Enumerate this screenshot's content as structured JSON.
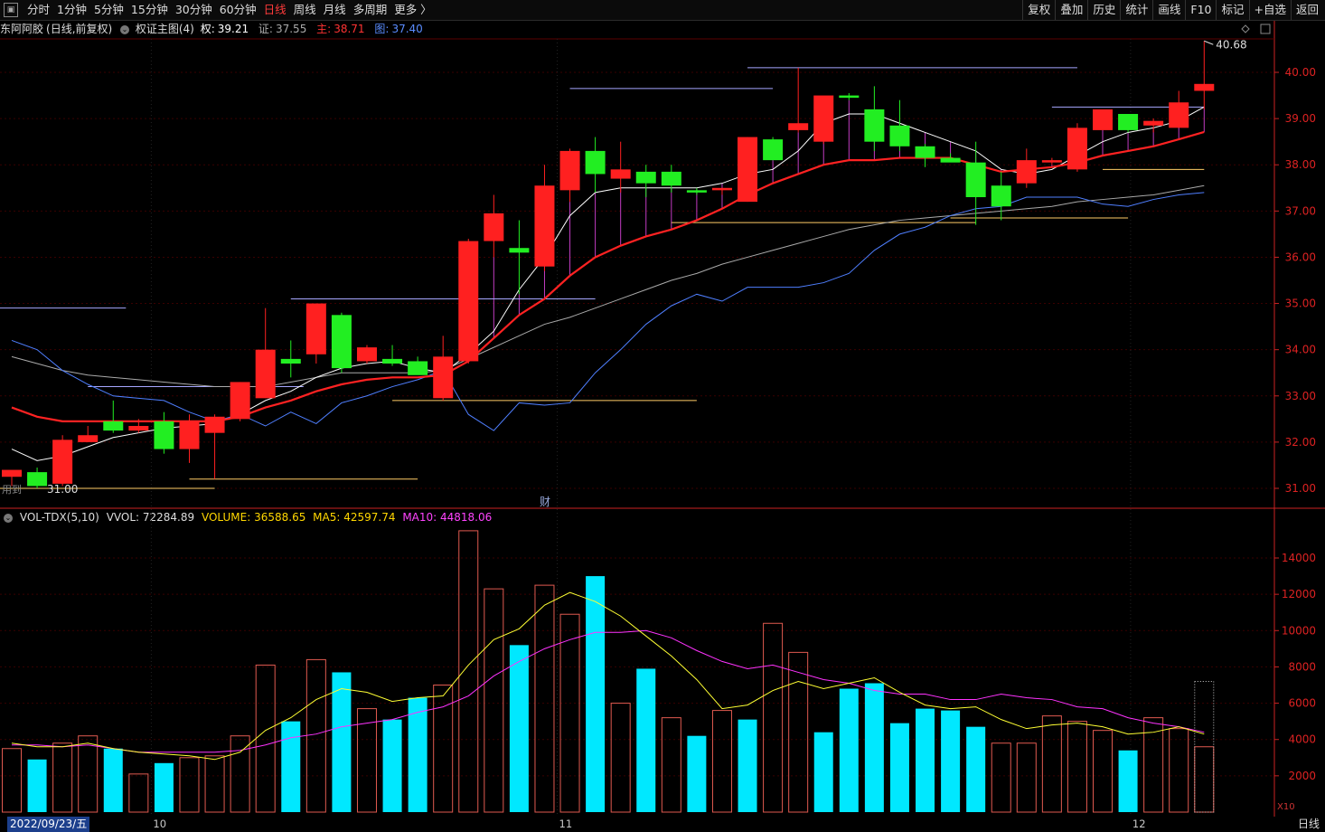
{
  "toolbar": {
    "tabs": [
      {
        "label": "分时",
        "active": false
      },
      {
        "label": "1分钟",
        "active": false
      },
      {
        "label": "5分钟",
        "active": false
      },
      {
        "label": "15分钟",
        "active": false
      },
      {
        "label": "30分钟",
        "active": false
      },
      {
        "label": "60分钟",
        "active": false
      },
      {
        "label": "日线",
        "active": true
      },
      {
        "label": "周线",
        "active": false
      },
      {
        "label": "月线",
        "active": false
      },
      {
        "label": "多周期",
        "active": false
      },
      {
        "label": "更多 〉",
        "active": false
      }
    ],
    "right_buttons": [
      "复权",
      "叠加",
      "历史",
      "统计",
      "画线",
      "F10",
      "标记",
      "+自选",
      "返回"
    ]
  },
  "info": {
    "name": "东阿阿胶",
    "mode": "(日线,前复权)",
    "indicator": "权证主图(4)",
    "quan_label": "权:",
    "quan_value": "39.21",
    "zheng_label": "证:",
    "zheng_value": "37.55",
    "zhu_label": "主:",
    "zhu_value": "38.71",
    "tu_label": "图:",
    "tu_value": "37.40"
  },
  "vol_info": {
    "name": "VOL-TDX(5,10)",
    "vvol": "VVOL: 72284.89",
    "volume": "VOLUME: 36588.65",
    "ma5": "MA5: 42597.74",
    "ma10": "MA10: 44818.06"
  },
  "annotations": {
    "high_label": "40.68",
    "low_label": "31.00",
    "cai_label": "财",
    "left_label": "用到"
  },
  "bottom": {
    "date": "2022/09/23/五",
    "period": "日线",
    "x10": "X10",
    "month_labels": [
      "10",
      "11",
      "12"
    ]
  },
  "colors": {
    "up": "#ff2020",
    "down": "#00e8ff",
    "candle_down": "#22ee22",
    "zhu": "#ff2222",
    "quan": "#ffffff",
    "zheng": "#aaaaaa",
    "tu": "#4f7fff",
    "ma5": "#ffff33",
    "ma10": "#ff33ff",
    "axis": "#cc2222"
  },
  "chart_data": [
    {
      "type": "candlestick",
      "ylim": [
        30.7,
        41.0
      ],
      "y_ticks": [
        31.0,
        32.0,
        33.0,
        34.0,
        35.0,
        36.0,
        37.0,
        38.0,
        39.0,
        40.0
      ],
      "candles": [
        {
          "o": 31.25,
          "h": 31.35,
          "l": 31.05,
          "c": 31.4
        },
        {
          "o": 31.35,
          "h": 31.45,
          "l": 31.0,
          "c": 31.05
        },
        {
          "o": 31.1,
          "h": 32.15,
          "l": 31.05,
          "c": 32.05
        },
        {
          "o": 32.0,
          "h": 32.35,
          "l": 32.0,
          "c": 32.15
        },
        {
          "o": 32.45,
          "h": 32.9,
          "l": 32.2,
          "c": 32.25
        },
        {
          "o": 32.25,
          "h": 32.5,
          "l": 32.2,
          "c": 32.35
        },
        {
          "o": 32.45,
          "h": 32.65,
          "l": 31.75,
          "c": 31.85
        },
        {
          "o": 31.85,
          "h": 32.6,
          "l": 31.55,
          "c": 32.45
        },
        {
          "o": 32.2,
          "h": 32.6,
          "l": 31.2,
          "c": 32.55
        },
        {
          "o": 32.5,
          "h": 33.3,
          "l": 32.45,
          "c": 33.3
        },
        {
          "o": 32.95,
          "h": 34.9,
          "l": 32.95,
          "c": 34.0
        },
        {
          "o": 33.8,
          "h": 34.2,
          "l": 33.4,
          "c": 33.7
        },
        {
          "o": 33.9,
          "h": 35.0,
          "l": 33.7,
          "c": 35.0
        },
        {
          "o": 34.75,
          "h": 34.8,
          "l": 33.5,
          "c": 33.6
        },
        {
          "o": 33.75,
          "h": 34.1,
          "l": 33.7,
          "c": 34.05
        },
        {
          "o": 33.8,
          "h": 34.1,
          "l": 33.65,
          "c": 33.7
        },
        {
          "o": 33.75,
          "h": 33.85,
          "l": 33.5,
          "c": 33.45
        },
        {
          "o": 32.95,
          "h": 34.3,
          "l": 32.9,
          "c": 33.85
        },
        {
          "o": 33.75,
          "h": 36.4,
          "l": 33.7,
          "c": 36.35
        },
        {
          "o": 36.35,
          "h": 37.35,
          "l": 36.0,
          "c": 36.95
        },
        {
          "o": 36.2,
          "h": 36.8,
          "l": 35.2,
          "c": 36.1
        },
        {
          "o": 35.8,
          "h": 38.0,
          "l": 35.7,
          "c": 37.55
        },
        {
          "o": 37.45,
          "h": 38.35,
          "l": 37.2,
          "c": 38.3
        },
        {
          "o": 38.3,
          "h": 38.6,
          "l": 37.4,
          "c": 37.8
        },
        {
          "o": 37.7,
          "h": 38.5,
          "l": 37.4,
          "c": 37.9
        },
        {
          "o": 37.85,
          "h": 38.0,
          "l": 37.3,
          "c": 37.6
        },
        {
          "o": 37.85,
          "h": 38.0,
          "l": 37.4,
          "c": 37.55
        },
        {
          "o": 37.45,
          "h": 37.5,
          "l": 37.35,
          "c": 37.4
        },
        {
          "o": 37.45,
          "h": 37.5,
          "l": 37.35,
          "c": 37.5
        },
        {
          "o": 37.2,
          "h": 38.6,
          "l": 37.2,
          "c": 38.6
        },
        {
          "o": 38.55,
          "h": 38.6,
          "l": 38.1,
          "c": 38.1
        },
        {
          "o": 38.75,
          "h": 40.1,
          "l": 38.7,
          "c": 38.9
        },
        {
          "o": 38.5,
          "h": 39.35,
          "l": 38.45,
          "c": 39.5
        },
        {
          "o": 39.5,
          "h": 39.55,
          "l": 39.4,
          "c": 39.45
        },
        {
          "o": 39.2,
          "h": 39.7,
          "l": 38.3,
          "c": 38.5
        },
        {
          "o": 38.85,
          "h": 39.4,
          "l": 38.3,
          "c": 38.4
        },
        {
          "o": 38.4,
          "h": 38.45,
          "l": 37.95,
          "c": 38.15
        },
        {
          "o": 38.15,
          "h": 38.25,
          "l": 38.1,
          "c": 38.05
        },
        {
          "o": 38.05,
          "h": 38.5,
          "l": 36.7,
          "c": 37.3
        },
        {
          "o": 37.55,
          "h": 37.85,
          "l": 36.8,
          "c": 37.1
        },
        {
          "o": 37.6,
          "h": 38.35,
          "l": 37.5,
          "c": 38.1
        },
        {
          "o": 38.05,
          "h": 38.15,
          "l": 38.0,
          "c": 38.1
        },
        {
          "o": 37.9,
          "h": 38.9,
          "l": 37.85,
          "c": 38.8
        },
        {
          "o": 38.75,
          "h": 39.15,
          "l": 38.75,
          "c": 39.2
        },
        {
          "o": 39.1,
          "h": 39.1,
          "l": 38.7,
          "c": 38.75
        },
        {
          "o": 38.85,
          "h": 39.0,
          "l": 38.7,
          "c": 38.95
        },
        {
          "o": 38.8,
          "h": 39.6,
          "l": 38.8,
          "c": 39.35
        },
        {
          "o": 39.6,
          "h": 40.68,
          "l": 39.2,
          "c": 39.75
        }
      ],
      "lines": {
        "quan": [
          31.85,
          31.6,
          31.7,
          31.9,
          32.1,
          32.2,
          32.3,
          32.35,
          32.4,
          32.6,
          32.9,
          33.1,
          33.4,
          33.6,
          33.7,
          33.75,
          33.6,
          33.5,
          33.9,
          34.4,
          35.3,
          36.0,
          36.9,
          37.4,
          37.5,
          37.5,
          37.5,
          37.5,
          37.6,
          37.8,
          37.9,
          38.3,
          38.9,
          39.1,
          39.1,
          38.9,
          38.7,
          38.5,
          38.3,
          37.9,
          37.8,
          37.9,
          38.2,
          38.5,
          38.7,
          38.8,
          38.95,
          39.25
        ],
        "zhu": [
          32.75,
          32.55,
          32.45,
          32.45,
          32.45,
          32.45,
          32.45,
          32.45,
          32.45,
          32.55,
          32.75,
          32.9,
          33.1,
          33.25,
          33.35,
          33.4,
          33.4,
          33.45,
          33.75,
          34.25,
          34.75,
          35.1,
          35.6,
          36.0,
          36.25,
          36.45,
          36.6,
          36.8,
          37.05,
          37.35,
          37.6,
          37.8,
          38.0,
          38.1,
          38.1,
          38.15,
          38.15,
          38.15,
          38.0,
          37.85,
          37.9,
          37.95,
          38.05,
          38.2,
          38.3,
          38.4,
          38.55,
          38.71
        ],
        "zheng": [
          33.85,
          33.7,
          33.55,
          33.45,
          33.4,
          33.35,
          33.3,
          33.25,
          33.2,
          33.2,
          33.2,
          33.3,
          33.4,
          33.5,
          33.5,
          33.5,
          33.5,
          33.55,
          33.8,
          34.05,
          34.3,
          34.55,
          34.7,
          34.9,
          35.1,
          35.3,
          35.5,
          35.65,
          35.85,
          36.0,
          36.15,
          36.3,
          36.45,
          36.6,
          36.7,
          36.8,
          36.85,
          36.9,
          36.95,
          37.0,
          37.05,
          37.1,
          37.2,
          37.25,
          37.3,
          37.35,
          37.45,
          37.55
        ],
        "tu": [
          34.2,
          34.0,
          33.55,
          33.25,
          33.0,
          32.95,
          32.9,
          32.65,
          32.45,
          32.6,
          32.35,
          32.65,
          32.4,
          32.85,
          33.0,
          33.2,
          33.35,
          33.55,
          32.6,
          32.25,
          32.85,
          32.8,
          32.85,
          33.5,
          34.0,
          34.55,
          34.95,
          35.2,
          35.05,
          35.35,
          35.35,
          35.35,
          35.45,
          35.65,
          36.15,
          36.5,
          36.65,
          36.9,
          37.05,
          37.1,
          37.3,
          37.3,
          37.3,
          37.15,
          37.1,
          37.25,
          37.35,
          37.4
        ]
      },
      "hlines": [
        {
          "y": 34.9,
          "x0": 0,
          "x1": 4,
          "color": "#a7a7ff"
        },
        {
          "y": 33.2,
          "x0": 3.5,
          "x1": 11,
          "color": "#a7a7ff"
        },
        {
          "y": 35.1,
          "x0": 11.5,
          "x1": 22.5,
          "color": "#a7a7ff"
        },
        {
          "y": 39.65,
          "x0": 22.5,
          "x1": 29.5,
          "color": "#a7a7ff"
        },
        {
          "y": 40.1,
          "x0": 29.5,
          "x1": 41.5,
          "color": "#a7a7ff"
        },
        {
          "y": 39.25,
          "x0": 41.5,
          "x1": 46.5,
          "color": "#a7a7ff"
        },
        {
          "y": 31.0,
          "x0": 0,
          "x1": 7.5,
          "color": "#ffcc66"
        },
        {
          "y": 31.2,
          "x0": 7.5,
          "x1": 15.5,
          "color": "#ffcc66"
        },
        {
          "y": 32.9,
          "x0": 15.5,
          "x1": 26.5,
          "color": "#ffcc66"
        },
        {
          "y": 36.75,
          "x0": 26.5,
          "x1": 37.5,
          "color": "#ffcc66"
        },
        {
          "y": 36.85,
          "x0": 37.5,
          "x1": 43.5,
          "color": "#ffcc66"
        },
        {
          "y": 37.9,
          "x0": 43.5,
          "x1": 46.5,
          "color": "#ffcc66"
        }
      ]
    },
    {
      "type": "bar",
      "title": "VOL-TDX(5,10)",
      "y_ticks": [
        2000,
        4000,
        6000,
        8000,
        10000,
        12000,
        14000
      ],
      "ylim": [
        0,
        16000
      ],
      "values": [
        3500,
        2900,
        3800,
        4200,
        3500,
        2100,
        2700,
        3000,
        3100,
        4200,
        8100,
        5000,
        8400,
        7700,
        5700,
        5100,
        6300,
        7000,
        15500,
        12300,
        9200,
        12500,
        10900,
        13000,
        6000,
        7900,
        5200,
        4200,
        5600,
        5100,
        10400,
        8800,
        4400,
        6800,
        7100,
        4900,
        5700,
        5600,
        4700,
        3800,
        3800,
        5300,
        5000,
        4500,
        3400,
        5200,
        4600,
        3600
      ],
      "up": [
        true,
        false,
        true,
        true,
        false,
        true,
        false,
        true,
        true,
        true,
        true,
        false,
        true,
        false,
        true,
        false,
        false,
        true,
        true,
        true,
        false,
        true,
        true,
        false,
        true,
        false,
        true,
        false,
        true,
        false,
        true,
        true,
        false,
        false,
        false,
        false,
        false,
        false,
        false,
        true,
        true,
        true,
        true,
        true,
        false,
        true,
        true,
        true
      ],
      "ma5": [
        3800,
        3600,
        3600,
        3800,
        3500,
        3300,
        3200,
        3100,
        2900,
        3300,
        4500,
        5200,
        6200,
        6800,
        6600,
        6100,
        6300,
        6400,
        8100,
        9500,
        10100,
        11400,
        12100,
        11600,
        10800,
        9700,
        8600,
        7300,
        5700,
        5900,
        6700,
        7200,
        6800,
        7100,
        7400,
        6600,
        5900,
        5700,
        5800,
        5100,
        4600,
        4800,
        4900,
        4700,
        4300,
        4400,
        4700,
        4300
      ],
      "ma10": [
        3700,
        3700,
        3600,
        3700,
        3500,
        3300,
        3300,
        3300,
        3300,
        3400,
        3700,
        4100,
        4300,
        4700,
        4900,
        5100,
        5500,
        5800,
        6400,
        7500,
        8300,
        9000,
        9500,
        9900,
        9900,
        10000,
        9600,
        8900,
        8300,
        7900,
        8100,
        7700,
        7300,
        7100,
        6700,
        6500,
        6500,
        6200,
        6200,
        6500,
        6300,
        6200,
        5800,
        5700,
        5200,
        4900,
        4700,
        4400
      ],
      "partial_last": 7200
    }
  ]
}
